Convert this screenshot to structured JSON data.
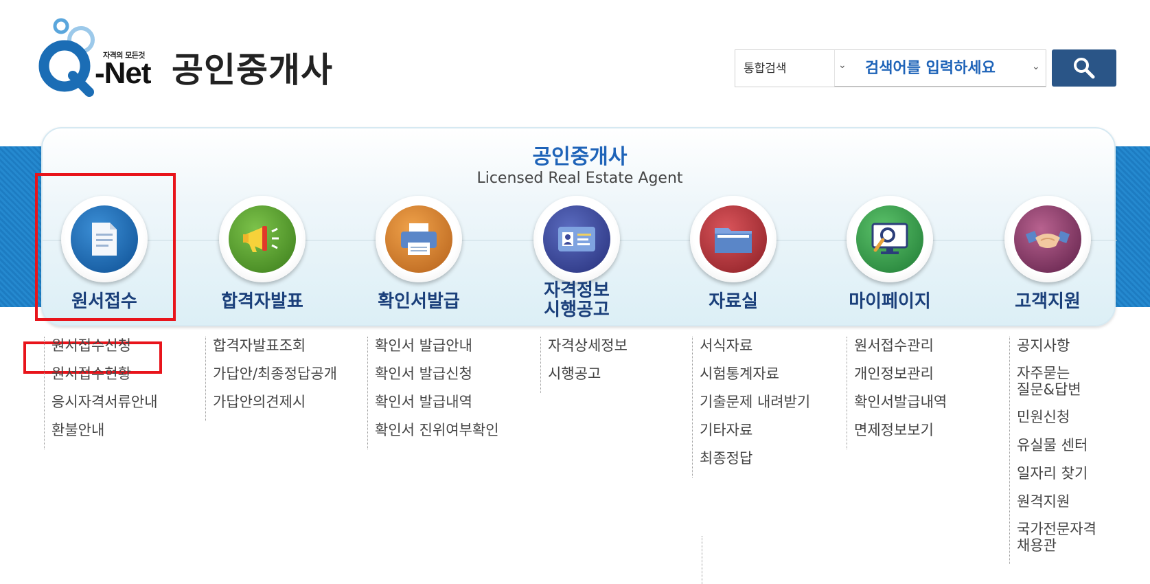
{
  "header": {
    "logo_tagline": "자격의 모든것",
    "logo_net": "-Net",
    "site_title": "공인중개사"
  },
  "search": {
    "scope": "통합검색",
    "placeholder": "검색어를 입력하세요"
  },
  "panel": {
    "title": "공인중개사",
    "subtitle": "Licensed Real Estate Agent"
  },
  "menus": [
    {
      "label": "원서접수",
      "icon": "document-icon",
      "color": "#1f6fb7",
      "items": [
        "원서접수신청",
        "원서접수현황",
        "응시자격서류안내",
        "환불안내"
      ]
    },
    {
      "label": "합격자발표",
      "icon": "megaphone-icon",
      "color": "#4f9a2a",
      "items": [
        "합격자발표조회",
        "가답안/최종정답공개",
        "가답안의견제시"
      ]
    },
    {
      "label": "확인서발급",
      "icon": "printer-icon",
      "color": "#d9822b",
      "items": [
        "확인서 발급안내",
        "확인서 발급신청",
        "확인서 발급내역",
        "확인서 진위여부확인"
      ]
    },
    {
      "label_line1": "자격정보",
      "label_line2": "시행공고",
      "icon": "id-card-icon",
      "color": "#3d4a9a",
      "items": [
        "자격상세정보",
        "시행공고"
      ]
    },
    {
      "label": "자료실",
      "icon": "folder-icon",
      "color": "#b8323a",
      "items": [
        "서식자료",
        "시험통계자료",
        "기출문제 내려받기",
        "기타자료",
        "최종정답"
      ]
    },
    {
      "label": "마이페이지",
      "icon": "monitor-search-icon",
      "color": "#2f9a4a",
      "items": [
        "원서접수관리",
        "개인정보관리",
        "확인서발급내역",
        "면제정보보기"
      ]
    },
    {
      "label": "고객지원",
      "icon": "handshake-icon",
      "color": "#8a3a6a",
      "items": [
        "공지사항",
        "자주묻는\n질문&답변",
        "민원신청",
        "유실물 센터",
        "일자리 찾기",
        "원격지원",
        "국가전문자격\n채용관"
      ]
    }
  ]
}
